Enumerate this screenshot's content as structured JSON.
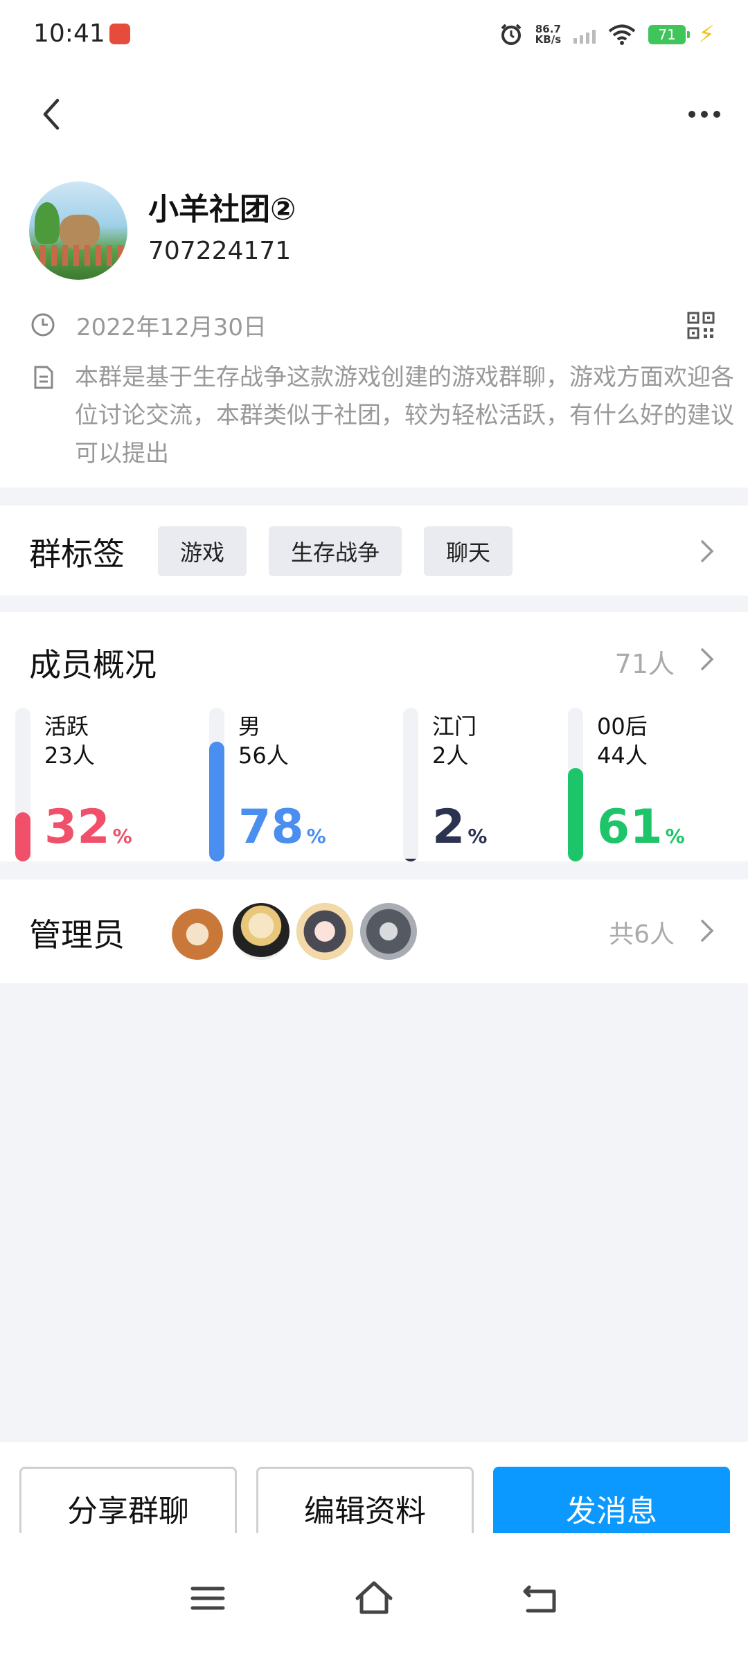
{
  "status": {
    "time": "10:41",
    "net_speed_value": "86.7",
    "net_speed_unit": "KB/s",
    "battery": "71"
  },
  "profile": {
    "name": "小羊社团②",
    "id": "707224171",
    "date": "2022年12月30日",
    "description": "本群是基于生存战争这款游戏创建的游戏群聊，游戏方面欢迎各位讨论交流，本群类似于社团，较为轻松活跃，有什么好的建议可以提出"
  },
  "tags": {
    "title": "群标签",
    "items": [
      "游戏",
      "生存战争",
      "聊天"
    ]
  },
  "members": {
    "title": "成员概况",
    "total": "71人",
    "stats": [
      {
        "label": "活跃",
        "count": "23人",
        "percent": "32",
        "sign": "%",
        "fill": 0.32,
        "color": "#f0506a"
      },
      {
        "label": "男",
        "count": "56人",
        "percent": "78",
        "sign": "%",
        "fill": 0.78,
        "color": "#4a8ff0"
      },
      {
        "label": "江门",
        "count": "2人",
        "percent": "2",
        "sign": "%",
        "fill": 0.02,
        "color": "#2b3350"
      },
      {
        "label": "00后",
        "count": "44人",
        "percent": "61",
        "sign": "%",
        "fill": 0.61,
        "color": "#1ec46a"
      }
    ]
  },
  "admins": {
    "title": "管理员",
    "total": "共6人"
  },
  "actions": {
    "share": "分享群聊",
    "edit": "编辑资料",
    "send": "发消息"
  },
  "icons": {
    "back": "back-arrow-icon",
    "more": "more-dots-icon",
    "clock": "clock-icon",
    "qr": "qr-code-icon",
    "doc": "document-icon",
    "chevron": "chevron-right-icon"
  }
}
